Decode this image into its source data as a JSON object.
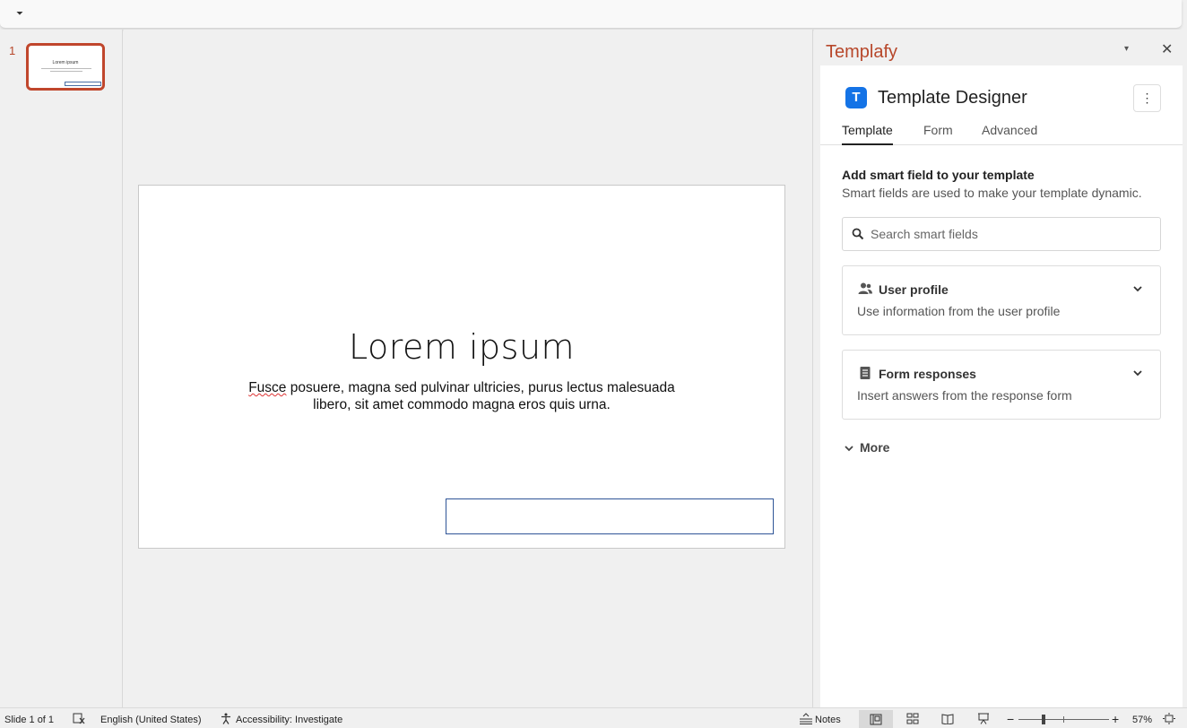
{
  "qat": {
    "icon": "customize-quick-access-icon",
    "glyph": "⏷"
  },
  "thumbnails": {
    "slide_number": "1",
    "title": "Lorem ipsum"
  },
  "slide": {
    "title": "Lorem ipsum",
    "body_word1": "Fusce",
    "body_rest": " posuere, magna sed pulvinar ultricies, purus lectus malesuada libero, sit amet commodo magna eros quis urna."
  },
  "task_pane": {
    "title": "Templafy",
    "menu_glyph": "▾",
    "close_glyph": "✕",
    "app": {
      "logo_letter": "T",
      "title": "Template Designer",
      "more_glyph": "⋮",
      "accent": "#1473e6"
    },
    "tabs": [
      {
        "label": "Template",
        "active": true
      },
      {
        "label": "Form",
        "active": false
      },
      {
        "label": "Advanced",
        "active": false
      }
    ],
    "section": {
      "heading": "Add smart field to your template",
      "subheading": "Smart fields are used to make your template dynamic."
    },
    "search": {
      "placeholder": "Search smart fields",
      "value": ""
    },
    "cards": [
      {
        "title": "User profile",
        "description": "Use information from the user profile",
        "icon": "users-icon"
      },
      {
        "title": "Form responses",
        "description": "Insert answers from the response form",
        "icon": "form-document-icon"
      }
    ],
    "more_label": "More"
  },
  "status_bar": {
    "slide_info": "Slide 1 of 1",
    "language": "English (United States)",
    "accessibility": "Accessibility: Investigate",
    "notes": "Notes",
    "zoom_minus": "−",
    "zoom_plus": "+",
    "zoom": "57%"
  },
  "colors": {
    "brand": "#b7472a",
    "thumb_border": "#c0462c",
    "placeholder_border": "#2f5597"
  }
}
